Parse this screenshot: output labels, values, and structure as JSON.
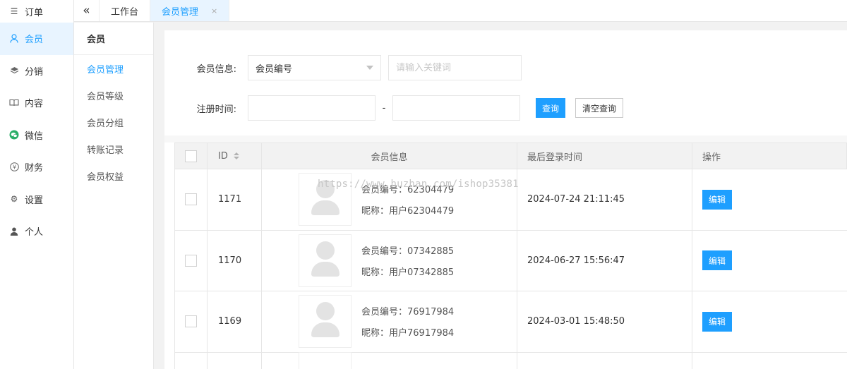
{
  "nav": {
    "items": [
      {
        "label": "订单",
        "icon": "list-icon"
      },
      {
        "label": "会员",
        "icon": "user-icon",
        "active": true
      },
      {
        "label": "分销",
        "icon": "layers-icon"
      },
      {
        "label": "内容",
        "icon": "book-icon"
      },
      {
        "label": "微信",
        "icon": "wechat-icon"
      },
      {
        "label": "财务",
        "icon": "yen-icon"
      },
      {
        "label": "设置",
        "icon": "gear-icon"
      },
      {
        "label": "个人",
        "icon": "person-icon"
      }
    ]
  },
  "tabs": {
    "items": [
      {
        "label": "工作台"
      },
      {
        "label": "会员管理",
        "active": true
      }
    ],
    "close": "×"
  },
  "subnav": {
    "title": "会员",
    "items": [
      {
        "label": "会员管理",
        "active": true
      },
      {
        "label": "会员等级"
      },
      {
        "label": "会员分组"
      },
      {
        "label": "转账记录"
      },
      {
        "label": "会员权益"
      }
    ]
  },
  "filters": {
    "member_info_label": "会员信息:",
    "member_field_selected": "会员编号",
    "keyword_placeholder": "请输入关键词",
    "register_time_label": "注册时间:",
    "range_sep": "-",
    "search_button": "查询",
    "clear_button": "清空查询"
  },
  "table": {
    "headers": {
      "id": "ID",
      "info": "会员信息",
      "last_login": "最后登录时间",
      "action": "操作"
    },
    "rows": [
      {
        "id": "1171",
        "member_no": "会员编号：62304479",
        "nickname": "昵称：用户62304479",
        "last_login": "2024-07-24 21:11:45",
        "action": "编辑"
      },
      {
        "id": "1170",
        "member_no": "会员编号：07342885",
        "nickname": "昵称：用户07342885",
        "last_login": "2024-06-27 15:56:47",
        "action": "编辑"
      },
      {
        "id": "1169",
        "member_no": "会员编号：76917984",
        "nickname": "昵称：用户76917984",
        "last_login": "2024-03-01 15:48:50",
        "action": "编辑"
      }
    ]
  },
  "watermark": "https://www.huzhan.com/ishop35381",
  "colors": {
    "accent": "#1e9fff",
    "active_bg": "#e8f4ff"
  }
}
